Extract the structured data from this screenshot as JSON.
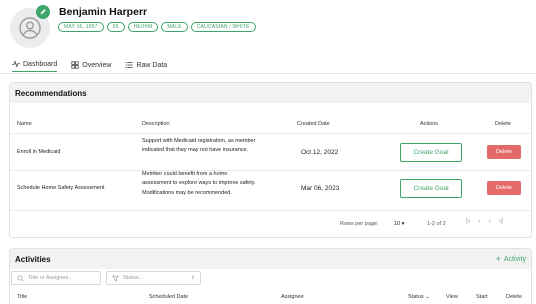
{
  "patient": {
    "name": "Benjamin Harperr",
    "chips": [
      "MAY 16, 1957",
      "65",
      "HE/HIM",
      "MALE",
      "CAUCASIAN / WHITE"
    ]
  },
  "tabs": [
    {
      "label": "Dashboard",
      "icon": "activity-icon",
      "active": true
    },
    {
      "label": "Overview",
      "icon": "grid-icon",
      "active": false
    },
    {
      "label": "Raw Data",
      "icon": "list-icon",
      "active": false
    }
  ],
  "recommendations": {
    "title": "Recommendations",
    "columns": [
      "Name",
      "Description",
      "Created Date",
      "Actions",
      "Delete"
    ],
    "rows": [
      {
        "name": "Enroll in Medicaid",
        "description": "Support with Medicaid registration, as member indicated that they may not have insurance.",
        "created": "Oct 12, 2022",
        "action": "Create Goal",
        "delete": "Delete"
      },
      {
        "name": "Schedule Home Safety Assessment",
        "description": "Member could benefit from a home assessment to explore ways to improve safety. Modifications may be recommended.",
        "created": "Mar 06, 2023",
        "action": "Create Goal",
        "delete": "Delete"
      }
    ],
    "pagination": {
      "rows_per_page_label": "Rows per page:",
      "rows_per_page": "10",
      "range": "1-2 of 2"
    }
  },
  "activities": {
    "title": "Activities",
    "add_label": "Activity",
    "filters": {
      "title_placeholder": "Title or Assignee...",
      "status_placeholder": "Status..."
    },
    "columns": [
      "Title",
      "Scheduled Date",
      "Assignee",
      "Status",
      "View",
      "Start",
      "Delete"
    ]
  },
  "colors": {
    "accent": "#3fa66b",
    "danger": "#e46a6a",
    "header_bg": "#f2f2f2"
  }
}
